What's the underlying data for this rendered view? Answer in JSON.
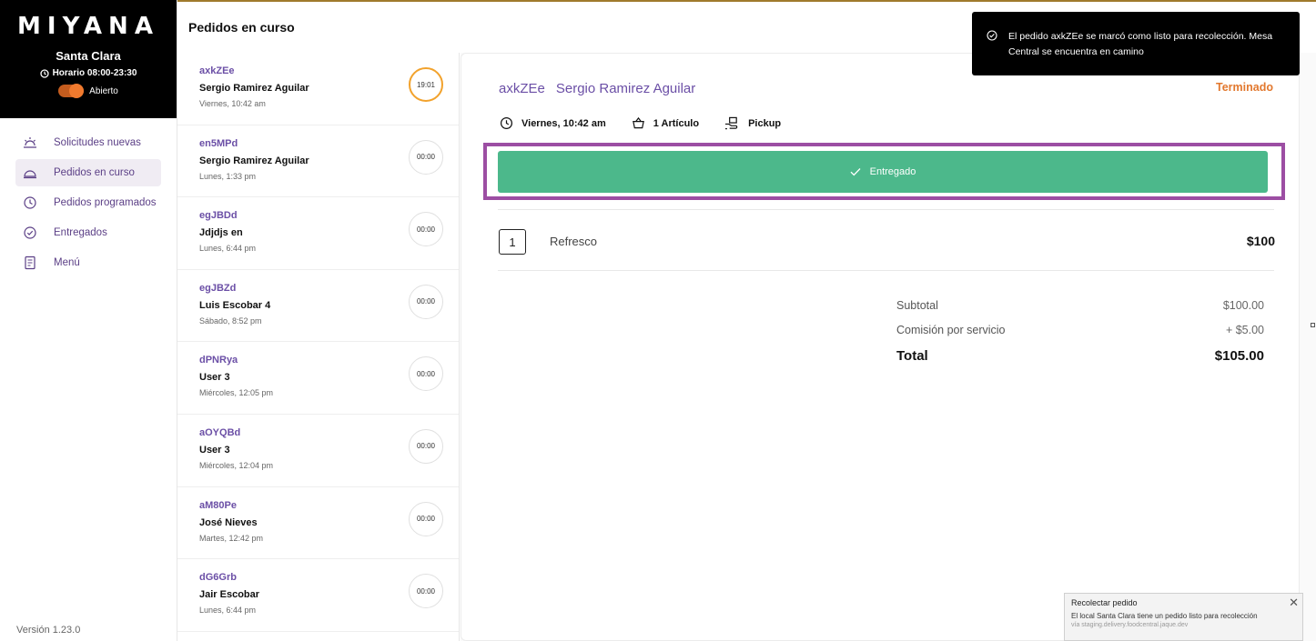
{
  "brand": {
    "logo": "MIYANA",
    "store": "Santa Clara",
    "hours": "Horario 08:00-23:30",
    "status": "Abierto"
  },
  "nav": [
    {
      "label": "Solicitudes nuevas",
      "icon": "sunrise-icon"
    },
    {
      "label": "Pedidos en curso",
      "icon": "cloche-icon"
    },
    {
      "label": "Pedidos programados",
      "icon": "clock-icon"
    },
    {
      "label": "Entregados",
      "icon": "check-circle-icon"
    },
    {
      "label": "Menú",
      "icon": "menu-doc-icon"
    }
  ],
  "version": "Versión 1.23.0",
  "list": {
    "title": "Pedidos en curso",
    "orders": [
      {
        "id": "axkZEe",
        "name": "Sergio Ramirez Aguilar",
        "date": "Viernes, 10:42 am",
        "timer": "19:01"
      },
      {
        "id": "en5MPd",
        "name": "Sergio Ramirez Aguilar",
        "date": "Lunes, 1:33 pm",
        "timer": "00:00"
      },
      {
        "id": "egJBDd",
        "name": "Jdjdjs en",
        "date": "Lunes, 6:44 pm",
        "timer": "00:00"
      },
      {
        "id": "egJBZd",
        "name": "Luis Escobar 4",
        "date": "Sábado, 8:52 pm",
        "timer": "00:00"
      },
      {
        "id": "dPNRya",
        "name": "User 3",
        "date": "Miércoles, 12:05 pm",
        "timer": "00:00"
      },
      {
        "id": "aOYQBd",
        "name": "User 3",
        "date": "Miércoles, 12:04 pm",
        "timer": "00:00"
      },
      {
        "id": "aM80Pe",
        "name": "José Nieves",
        "date": "Martes, 12:42 pm",
        "timer": "00:00"
      },
      {
        "id": "dG6Grb",
        "name": "Jair Escobar",
        "date": "Lunes, 6:44 pm",
        "timer": "00:00"
      }
    ]
  },
  "detail": {
    "order_id": "axkZEe",
    "customer": "Sergio Ramirez Aguilar",
    "status": "Terminado",
    "datetime": "Viernes, 10:42 am",
    "items_count": "1 Artículo",
    "mode": "Pickup",
    "action_label": "Entregado",
    "items": [
      {
        "qty": "1",
        "name": "Refresco",
        "price": "$100"
      }
    ],
    "subtotal_label": "Subtotal",
    "subtotal": "$100.00",
    "fee_label": "Comisión por servicio",
    "fee": "+ $5.00",
    "total_label": "Total",
    "total": "$105.00"
  },
  "toast": {
    "message": "El pedido axkZEe se marcó como listo para recolección. Mesa Central se encuentra en camino"
  },
  "notification": {
    "title": "Recolectar pedido",
    "body": "El local Santa Clara tiene un pedido listo para recolección",
    "source": "vía staging.delivery.foodcentral.jaque.dev"
  },
  "colors": {
    "accent": "#6b4fa6",
    "success": "#4cb88b",
    "status_orange": "#e2782e",
    "highlight": "#9c4ea3"
  }
}
